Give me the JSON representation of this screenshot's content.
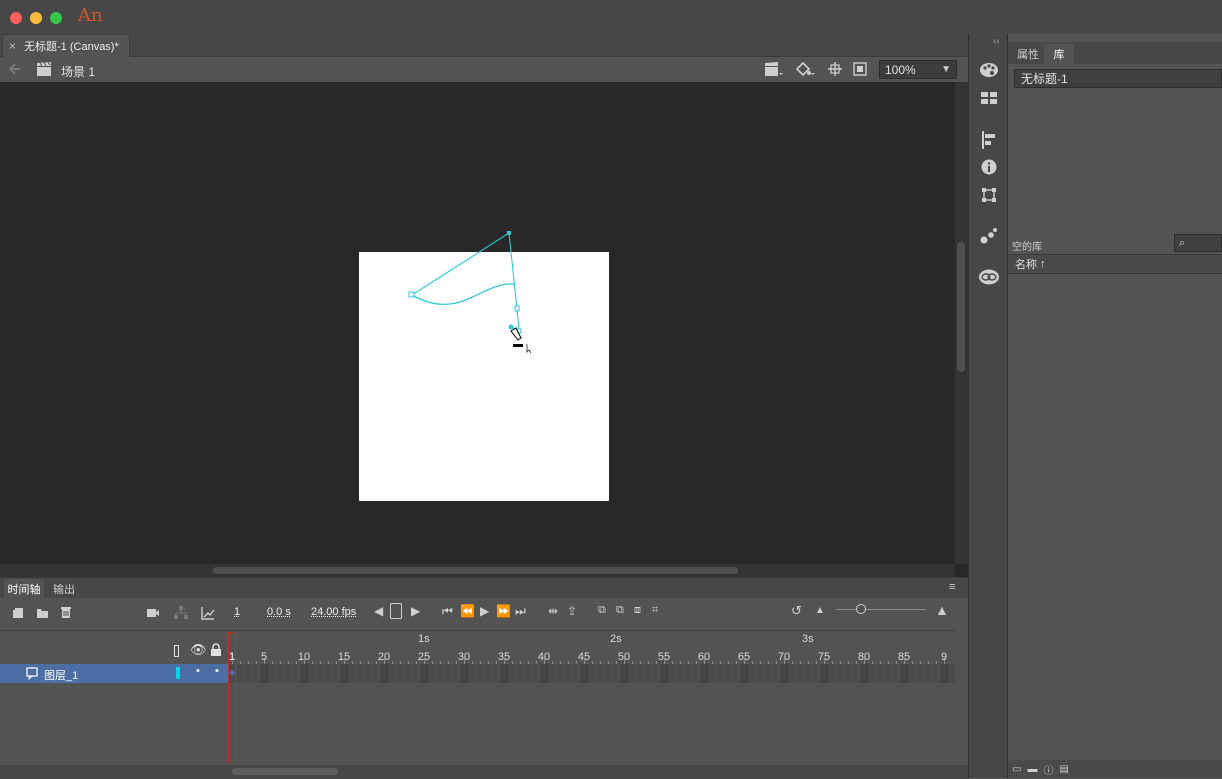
{
  "app": {
    "logo": "An"
  },
  "document_tab": {
    "title": "无标题-1 (Canvas)*",
    "close": "×"
  },
  "editbar": {
    "scene": "场景 1",
    "zoom": "100%"
  },
  "right_panel": {
    "tabs": [
      "属性",
      "库"
    ],
    "library_select": "无标题-1",
    "empty_library": "空的库",
    "name_column": "名称"
  },
  "timeline": {
    "tabs": [
      "时间轴",
      "输出"
    ],
    "current_frame": "1",
    "time": "0.0 s",
    "fps": "24.00 fps",
    "second_markers": [
      {
        "label": "1s",
        "frame": 24
      },
      {
        "label": "2s",
        "frame": 48
      },
      {
        "label": "3s",
        "frame": 72
      }
    ],
    "frame_ticks": [
      "1",
      "5",
      "10",
      "15",
      "20",
      "25",
      "30",
      "35",
      "40",
      "45",
      "50",
      "55",
      "60",
      "65",
      "70",
      "75",
      "80",
      "85",
      "9"
    ],
    "layers": [
      {
        "name": "图层_1"
      }
    ]
  },
  "colors": {
    "accent": "#00d6e8",
    "path": "#2ec8d8",
    "stage_bg": "#282828",
    "layer_selected": "#4b6fa5",
    "playhead": "#c42d2d"
  },
  "icons": {
    "back": "back-arrow-icon",
    "scene": "clapper-icon",
    "edit_symbols": "clapper-dropdown-icon",
    "edit_scene": "paint-bucket-icon",
    "snap": "crosshair-icon",
    "clip": "clip-icon"
  }
}
